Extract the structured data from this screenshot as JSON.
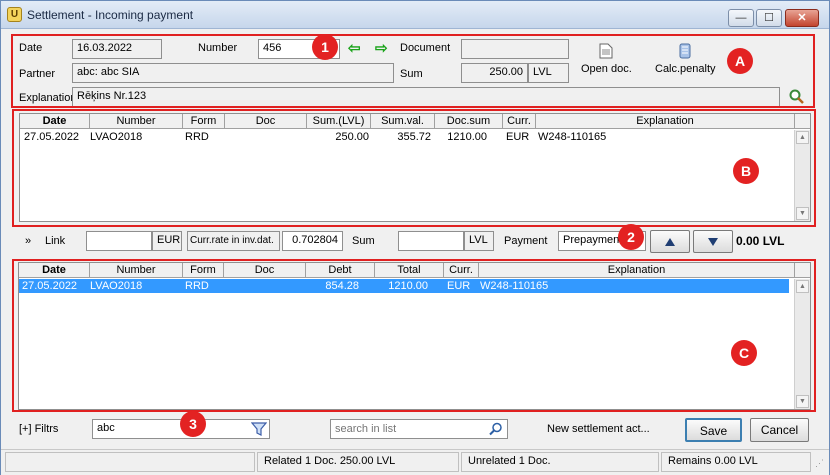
{
  "window": {
    "title": "Settlement - Incoming payment",
    "app_icon": "app-icon",
    "close_glyph": "✕",
    "min_glyph": "—",
    "max_glyph": "☐"
  },
  "header": {
    "date_label": "Date",
    "date_value": "16.03.2022",
    "number_label": "Number",
    "number_value": "456",
    "document_label": "Document",
    "document_value": "",
    "partner_label": "Partner",
    "partner_value": "abc: abc SIA",
    "sum_label": "Sum",
    "sum_value": "250.00",
    "sum_currency": "LVL",
    "open_doc_label": "Open doc.",
    "calc_penalty_label": "Calc.penalty",
    "explanation_label": "Explanation",
    "explanation_value": "Rēķins Nr.123",
    "arrow_left": "⇦",
    "arrow_right": "⇨"
  },
  "grid_b": {
    "columns": [
      "Date",
      "Number",
      "Form",
      "Doc",
      "Sum.(LVL)",
      "Sum.val.",
      "Doc.sum",
      "Curr.",
      "Explanation"
    ],
    "rows": [
      {
        "date": "27.05.2022",
        "number": "LVAO2018",
        "form": "RRD",
        "doc": "",
        "sum_lvl": "250.00",
        "sum_val": "355.72",
        "doc_sum": "1210.00",
        "curr": "EUR",
        "explanation": "W248-110165"
      }
    ]
  },
  "link_bar": {
    "link_label": "Link",
    "link_currency": "EUR",
    "rate_label": "Curr.rate in inv.dat.",
    "rate_value": "0.702804",
    "sum_label": "Sum",
    "sum_currency": "LVL",
    "payment_label": "Payment",
    "payment_value": "Prepayment",
    "total_label": "0.00 LVL"
  },
  "grid_c": {
    "columns": [
      "Date",
      "Number",
      "Form",
      "Doc",
      "Debt",
      "Total",
      "Curr.",
      "Explanation"
    ],
    "rows": [
      {
        "date": "27.05.2022",
        "number": "LVAO2018",
        "form": "RRD",
        "doc": "",
        "debt": "854.28",
        "total": "1210.00",
        "curr": "EUR",
        "explanation": "W248-110165"
      }
    ]
  },
  "bottom": {
    "filters_label": "[+] Filtrs",
    "filter_value": "abc",
    "search_placeholder": "search in list",
    "new_settlement_label": "New settlement act...",
    "save_label": "Save",
    "cancel_label": "Cancel"
  },
  "status": {
    "related": "Related 1 Doc. 250.00 LVL",
    "unrelated": "Unrelated 1 Doc.",
    "remains": "Remains 0.00 LVL"
  },
  "annotations": {
    "a": "A",
    "b": "B",
    "c": "C",
    "one": "1",
    "two": "2",
    "three": "3"
  },
  "colors": {
    "annotation_red": "#e02020",
    "selection_blue": "#3399ff",
    "arrow_green": "#1aa31a"
  }
}
